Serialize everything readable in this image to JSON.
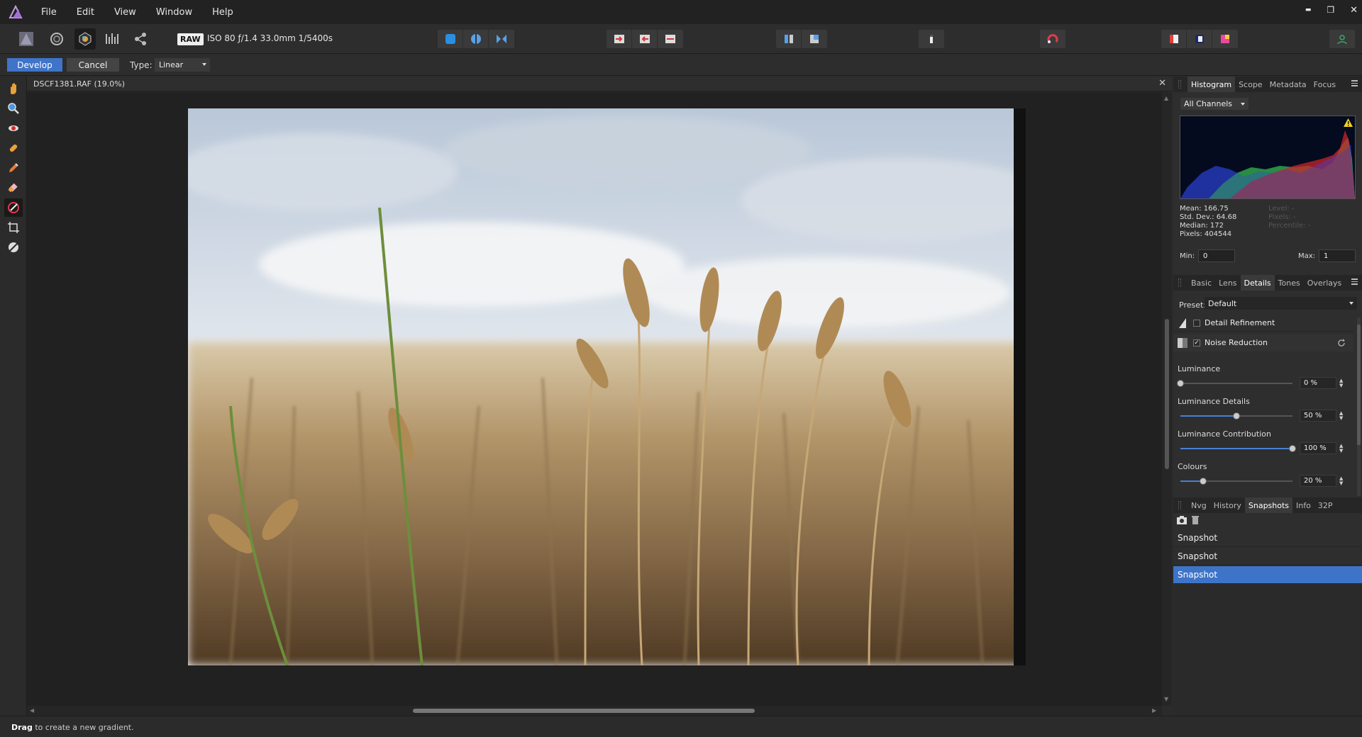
{
  "menu": {
    "items": [
      "File",
      "Edit",
      "View",
      "Window",
      "Help"
    ]
  },
  "window_controls": {
    "minimize": "▬",
    "restore": "❐",
    "close": "✕"
  },
  "toolbar": {
    "raw_badge": "RAW",
    "exif": "ISO 80 ƒ/1.4 33.0mm 1/5400s"
  },
  "context": {
    "develop_label": "Develop",
    "cancel_label": "Cancel",
    "type_label": "Type:",
    "type_value": "Linear"
  },
  "document": {
    "title": "DSCF1381.RAF (19.0%)",
    "close": "✕"
  },
  "histogram_panel": {
    "tabs": [
      "Histogram",
      "Scope",
      "Metadata",
      "Focus"
    ],
    "active_tab": 0,
    "channels": "All Channels",
    "stats_left": [
      "Mean: 166.75",
      "Std. Dev.: 64.68",
      "Median: 172",
      "Pixels: 404544"
    ],
    "stats_right": [
      "Level: -",
      "Pixels: -",
      "Percentile: -"
    ],
    "min_label": "Min:",
    "min_value": "0",
    "max_label": "Max:",
    "max_value": "1",
    "warning_icon": "warning-icon"
  },
  "develop_panel": {
    "tabs": [
      "Basic",
      "Lens",
      "Details",
      "Tones",
      "Overlays"
    ],
    "active_tab": 2,
    "preset_label": "Preset:",
    "preset_value": "Default",
    "detail_refinement": {
      "label": "Detail Refinement",
      "checked": false
    },
    "noise_reduction": {
      "label": "Noise Reduction",
      "checked": true
    },
    "sliders": [
      {
        "label": "Luminance",
        "value": "0 %",
        "fraction": 0.0
      },
      {
        "label": "Luminance Details",
        "value": "50 %",
        "fraction": 0.5
      },
      {
        "label": "Luminance Contribution",
        "value": "100 %",
        "fraction": 1.0
      },
      {
        "label": "Colours",
        "value": "20 %",
        "fraction": 0.2
      }
    ],
    "accent": "#4a7fd4"
  },
  "snapshots_panel": {
    "tabs": [
      "Nvg",
      "History",
      "Snapshots",
      "Info",
      "32P"
    ],
    "active_tab": 2,
    "items": [
      "Snapshot",
      "Snapshot",
      "Snapshot"
    ],
    "selected_index": 2
  },
  "status": {
    "bold": "Drag",
    "text": " to create a new gradient."
  },
  "colors": {
    "selection": "#3e74c8",
    "develop_button": "#3f74c9"
  }
}
